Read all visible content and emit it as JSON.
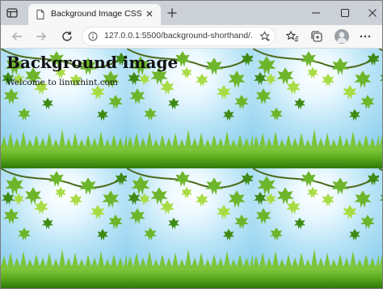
{
  "browser": {
    "tab": {
      "title": "Background Image CSS"
    },
    "address_bar": {
      "url": "127.0.0.1:5500/background-shorthand/..."
    }
  },
  "page": {
    "heading": "Background image",
    "paragraph": "Welcome to linuxhint.com"
  },
  "icons": {
    "tab_actions": "tab-actions-icon",
    "favicon": "page-favicon-icon",
    "close_tab": "close-icon",
    "new_tab": "plus-icon",
    "minimize": "minimize-icon",
    "maximize": "maximize-icon",
    "close_window": "close-window-icon",
    "back": "back-arrow-icon",
    "forward": "forward-arrow-icon",
    "refresh": "refresh-icon",
    "site_info": "info-icon",
    "favorite": "star-add-icon",
    "favorites": "favorites-icon",
    "collections": "collections-icon",
    "profile": "profile-avatar",
    "more": "more-menu-icon"
  },
  "colors": {
    "tab_strip": "#ccd1d8",
    "toolbar": "#f7f7f7",
    "sky_light": "#eaf8ff",
    "sky_blue": "#8fd0ef",
    "leaf_green": "#5fae1f",
    "grass_green": "#3f8f12"
  }
}
